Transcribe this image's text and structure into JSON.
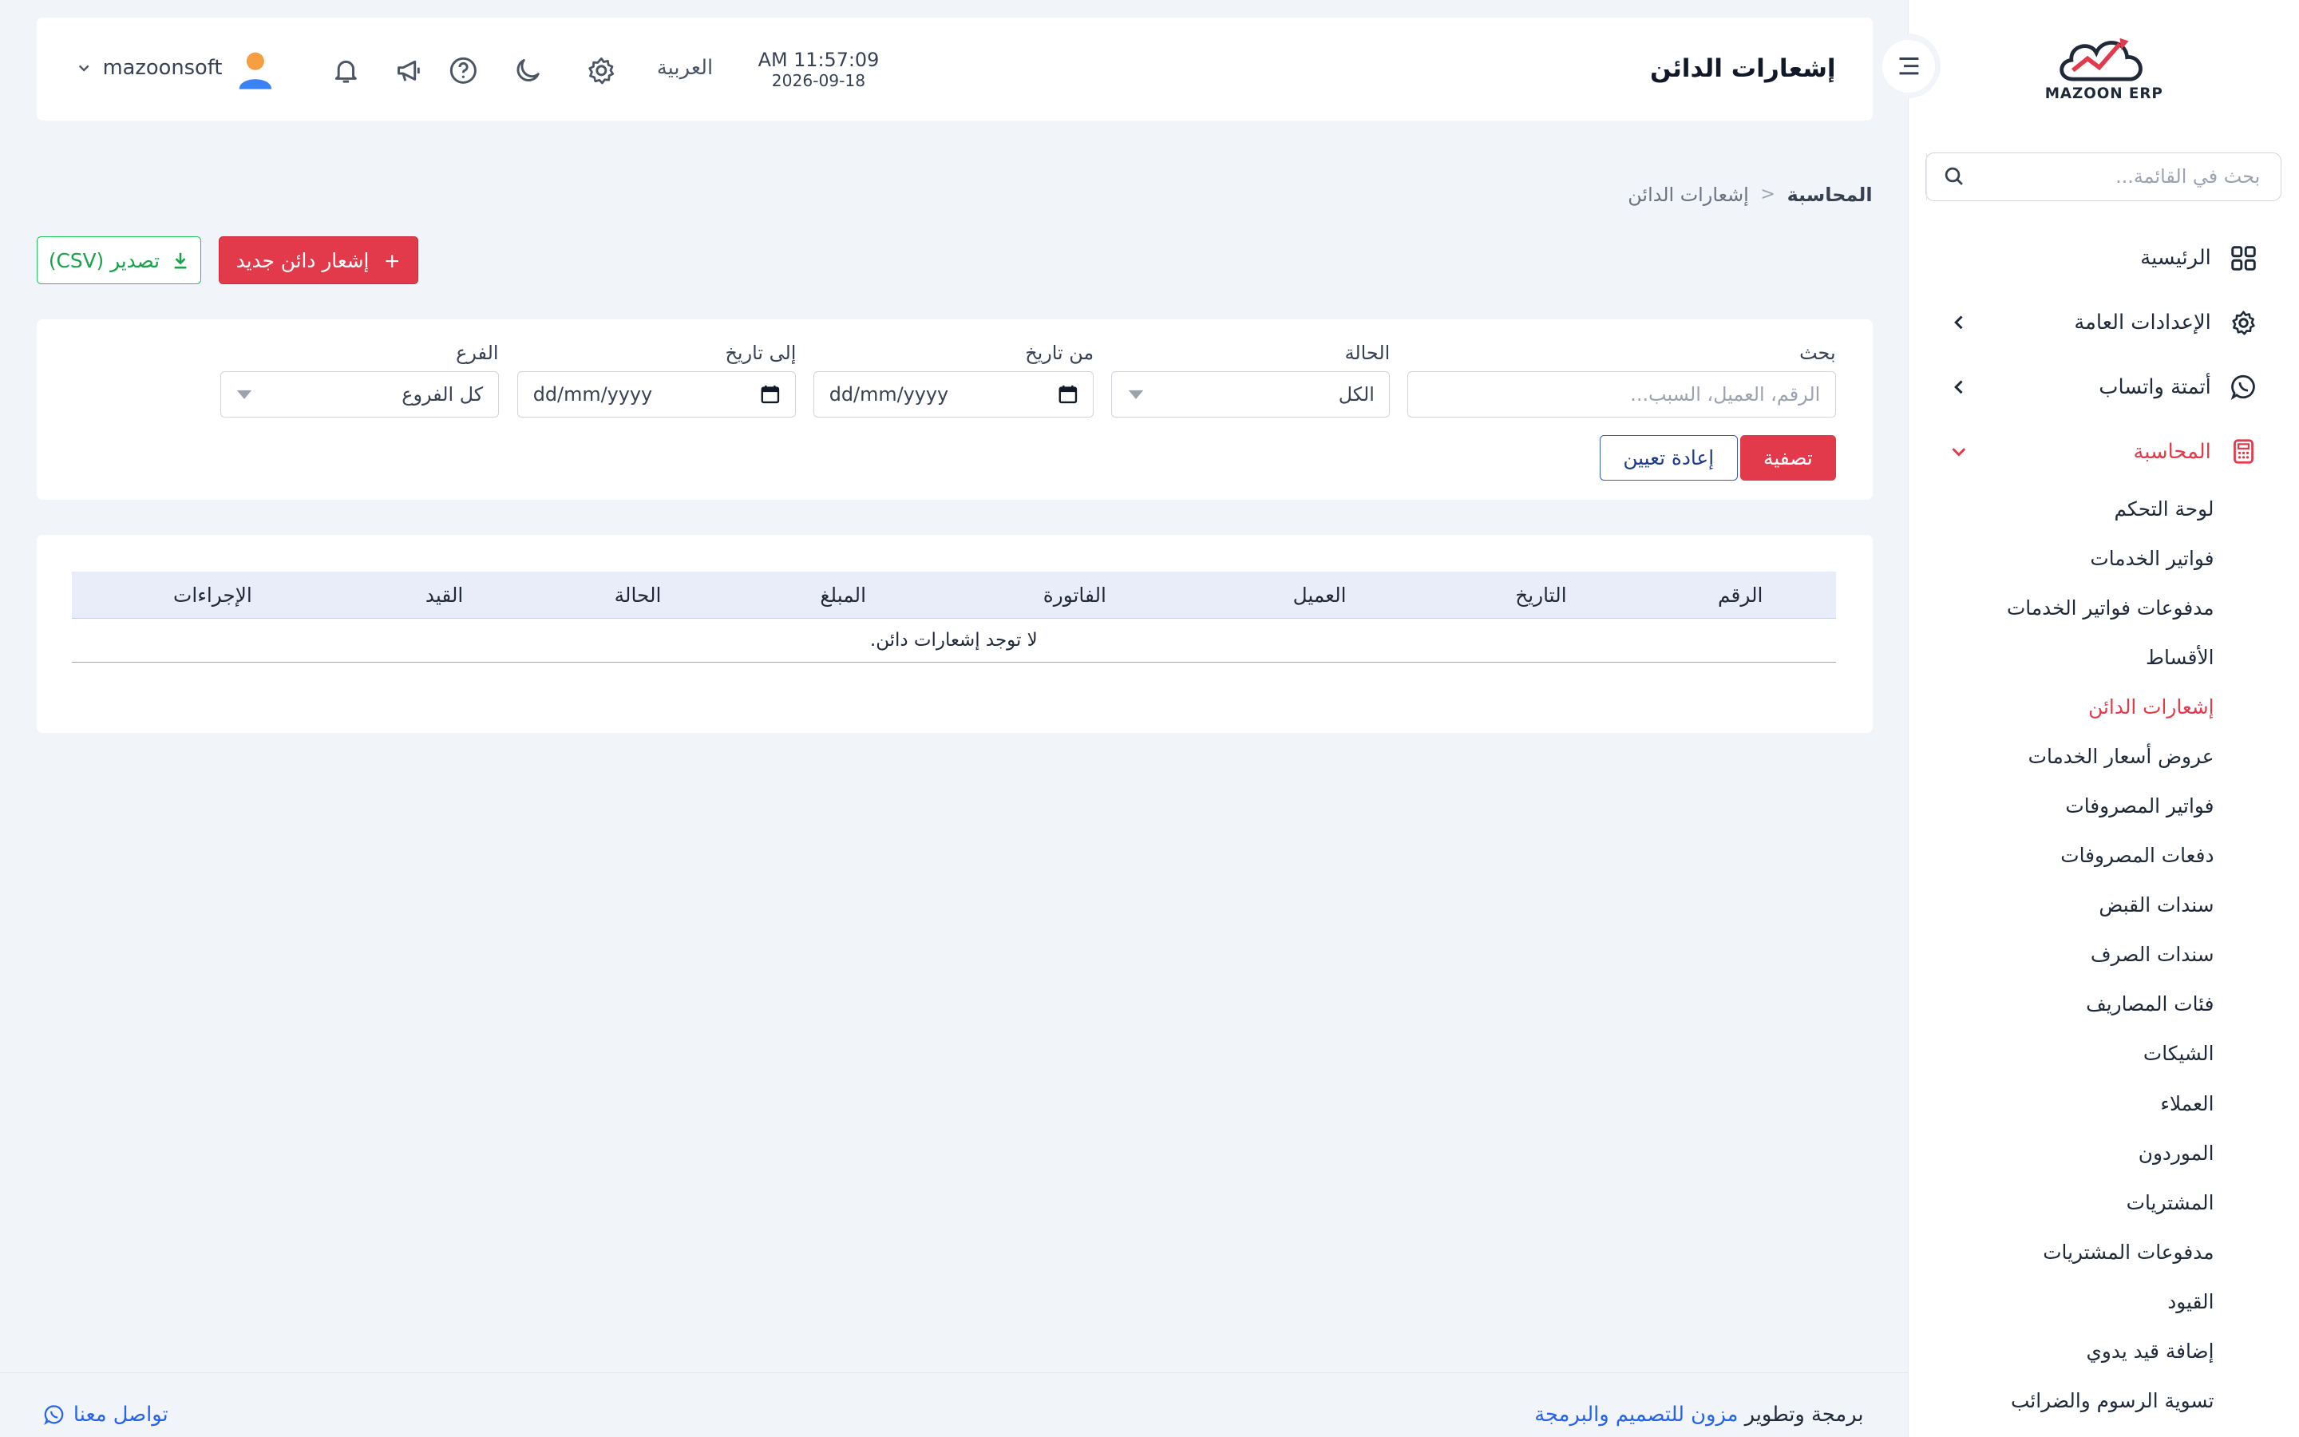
{
  "sidebar": {
    "logo_text": "MAZOON ERP",
    "search_placeholder": "بحث في القائمة...",
    "items": [
      {
        "label": "الرئيسية"
      },
      {
        "label": "الإعدادات العامة"
      },
      {
        "label": "أتمتة واتساب"
      },
      {
        "label": "المحاسبة"
      }
    ],
    "subitems": [
      "لوحة التحكم",
      "فواتير الخدمات",
      "مدفوعات فواتير الخدمات",
      "الأقساط",
      "إشعارات الدائن",
      "عروض أسعار الخدمات",
      "فواتير المصروفات",
      "دفعات المصروفات",
      "سندات القبض",
      "سندات الصرف",
      "فئات المصاريف",
      "الشيكات",
      "العملاء",
      "الموردون",
      "المشتريات",
      "مدفوعات المشتريات",
      "القيود",
      "إضافة قيد يدوي",
      "تسوية الرسوم والضرائب"
    ],
    "active_sub_index": 4
  },
  "header": {
    "title": "إشعارات الدائن",
    "time": "AM 11:57:09",
    "date": "2026-09-18",
    "language": "العربية",
    "username": "mazoonsoft"
  },
  "breadcrumb": {
    "root": "المحاسبة",
    "separator": "<",
    "current": "إشعارات الدائن"
  },
  "actions": {
    "new_label": "إشعار دائن جديد",
    "export_label": "تصدير (CSV)"
  },
  "filters": {
    "search": {
      "label": "بحث",
      "placeholder": "الرقم، العميل، السبب..."
    },
    "status": {
      "label": "الحالة",
      "value": "الكل"
    },
    "from_date": {
      "label": "من تاريخ",
      "placeholder": "dd/mm/yyyy"
    },
    "to_date": {
      "label": "إلى تاريخ",
      "placeholder": "dd/mm/yyyy"
    },
    "branch": {
      "label": "الفرع",
      "value": "كل الفروع"
    },
    "filter_label": "تصفية",
    "reset_label": "إعادة تعيين"
  },
  "table": {
    "columns": [
      "الرقم",
      "التاريخ",
      "العميل",
      "الفاتورة",
      "المبلغ",
      "الحالة",
      "القيد",
      "الإجراءات"
    ],
    "empty_message": "لا توجد إشعارات دائن."
  },
  "footer": {
    "credit_prefix": "برمجة وتطوير",
    "credit_link": "مزون للتصميم والبرمجة",
    "contact": "تواصل معنا"
  },
  "colors": {
    "accent": "#e23a4b",
    "export": "#16a34a",
    "link": "#2563eb"
  }
}
